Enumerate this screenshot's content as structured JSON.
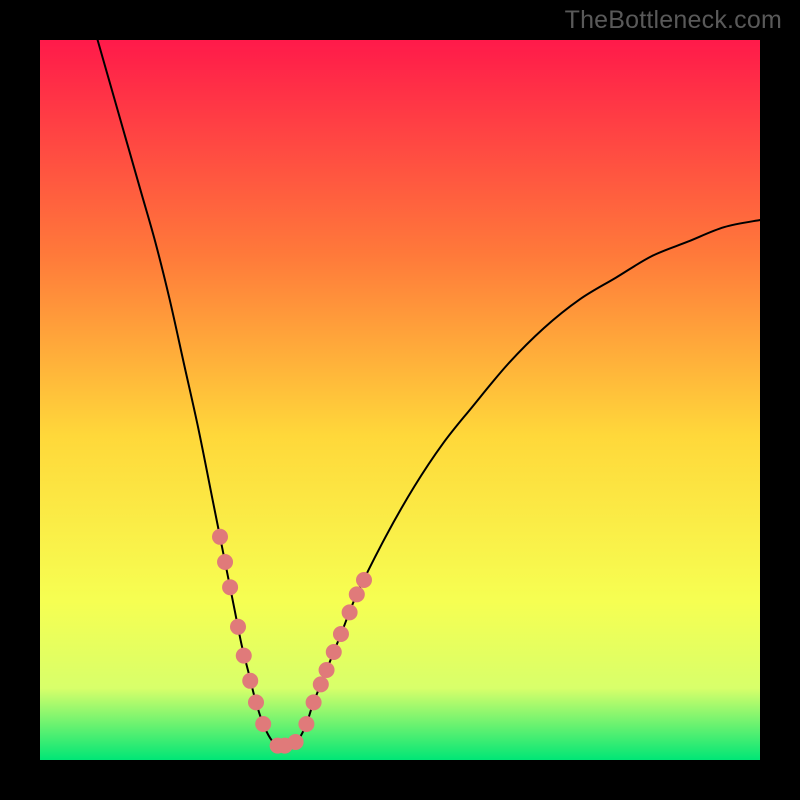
{
  "watermark": {
    "text": "TheBottleneck.com"
  },
  "colors": {
    "frame_bg": "#000000",
    "gradient_top": "#ff1a4a",
    "gradient_upper_mid": "#ff7a3a",
    "gradient_mid": "#ffd83a",
    "gradient_lower_mid": "#f6ff52",
    "gradient_bottom_band": "#d8ff6a",
    "gradient_bottom": "#00e676",
    "curve": "#000000",
    "marker_fill": "#e07a7a",
    "marker_stroke": "#c85a5a"
  },
  "chart_data": {
    "type": "line",
    "title": "",
    "xlabel": "",
    "ylabel": "",
    "xlim": [
      0,
      100
    ],
    "ylim": [
      0,
      100
    ],
    "grid": false,
    "series": [
      {
        "name": "bottleneck-curve",
        "x": [
          8,
          10,
          12,
          14,
          16,
          18,
          20,
          22,
          24,
          25,
          26,
          27,
          28,
          29,
          30,
          31,
          32,
          33,
          34,
          35,
          36,
          37,
          38,
          40,
          42,
          44,
          48,
          52,
          56,
          60,
          65,
          70,
          75,
          80,
          85,
          90,
          95,
          100
        ],
        "y": [
          100,
          93,
          86,
          79,
          72,
          64,
          55,
          46,
          36,
          31,
          26,
          21,
          16,
          12,
          8,
          5,
          3,
          2,
          2,
          2,
          3,
          5,
          8,
          13,
          18,
          23,
          31,
          38,
          44,
          49,
          55,
          60,
          64,
          67,
          70,
          72,
          74,
          75
        ]
      }
    ],
    "markers": {
      "name": "highlighted-points",
      "x": [
        25.0,
        25.7,
        26.4,
        27.5,
        28.3,
        29.2,
        30.0,
        31.0,
        33.0,
        34.0,
        35.5,
        37.0,
        38.0,
        39.0,
        39.8,
        40.8,
        41.8,
        43.0,
        44.0,
        45.0
      ],
      "y": [
        31.0,
        27.5,
        24.0,
        18.5,
        14.5,
        11.0,
        8.0,
        5.0,
        2.0,
        2.0,
        2.5,
        5.0,
        8.0,
        10.5,
        12.5,
        15.0,
        17.5,
        20.5,
        23.0,
        25.0
      ]
    }
  }
}
